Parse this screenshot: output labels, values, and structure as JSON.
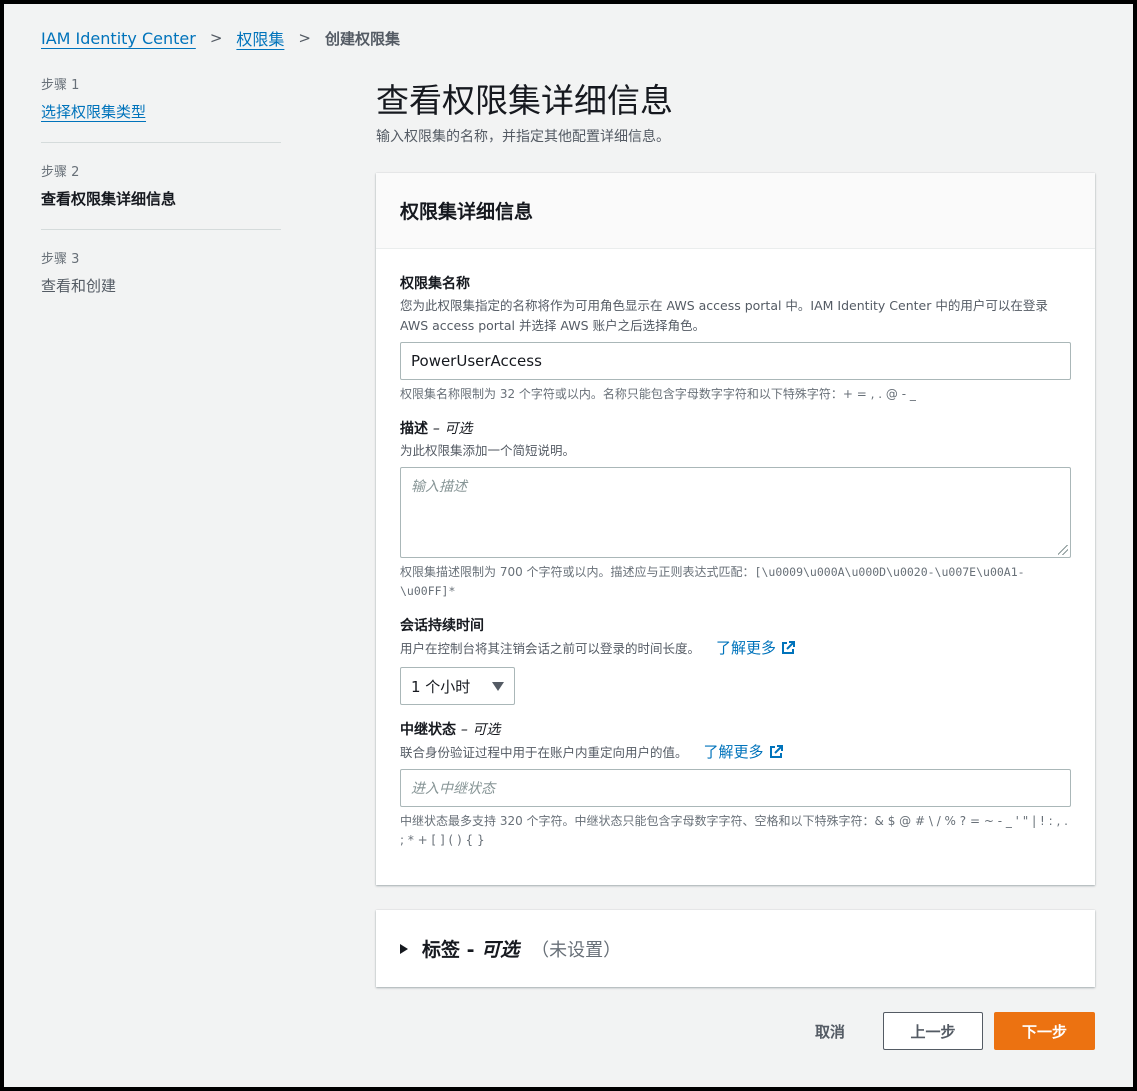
{
  "breadcrumb": {
    "items": [
      "IAM Identity Center",
      "权限集"
    ],
    "current": "创建权限集",
    "separator": ">"
  },
  "steps": [
    {
      "label": "步骤 1",
      "title": "选择权限集类型",
      "state": "link"
    },
    {
      "label": "步骤 2",
      "title": "查看权限集详细信息",
      "state": "current"
    },
    {
      "label": "步骤 3",
      "title": "查看和创建",
      "state": "disabled"
    }
  ],
  "header": {
    "title": "查看权限集详细信息",
    "description": "输入权限集的名称，并指定其他配置详细信息。"
  },
  "panel": {
    "title": "权限集详细信息",
    "name_field": {
      "label": "权限集名称",
      "description": "您为此权限集指定的名称将作为可用角色显示在 AWS access portal 中。IAM Identity Center 中的用户可以在登录 AWS access portal 并选择 AWS 账户之后选择角色。",
      "value": "PowerUserAccess",
      "constraint": "权限集名称限制为 32 个字符或以内。名称只能包含字母数字字符和以下特殊字符：+ = , . @ - _"
    },
    "description_field": {
      "label": "描述",
      "optional": "– 可选",
      "description": "为此权限集添加一个简短说明。",
      "placeholder": "输入描述",
      "constraint_text": "权限集描述限制为 700 个字符或以内。描述应与正则表达式匹配：",
      "constraint_regex": "[\\u0009\\u000A\\u000D\\u0020-\\u007E\\u00A1-\\u00FF]*"
    },
    "session_field": {
      "label": "会话持续时间",
      "description": "用户在控制台将其注销会话之前可以登录的时间长度。",
      "learn_more": "了解更多",
      "selected": "1 个小时"
    },
    "relay_field": {
      "label": "中继状态",
      "optional": "– 可选",
      "description": "联合身份验证过程中用于在账户内重定向用户的值。",
      "learn_more": "了解更多",
      "placeholder": "进入中继状态",
      "constraint": "中继状态最多支持 320 个字符。中继状态只能包含字母数字字符、空格和以下特殊字符：& $ @ # \\ / % ? = ~ - _ ' \" | ! : , . ; * + [ ] ( ) { }"
    }
  },
  "tags": {
    "title": "标签 -",
    "optional": "可选",
    "status": "（未设置）"
  },
  "footer": {
    "cancel": "取消",
    "previous": "上一步",
    "next": "下一步"
  },
  "colors": {
    "link": "#0073bb",
    "primary_button": "#ec7211",
    "background": "#f2f3f3"
  }
}
